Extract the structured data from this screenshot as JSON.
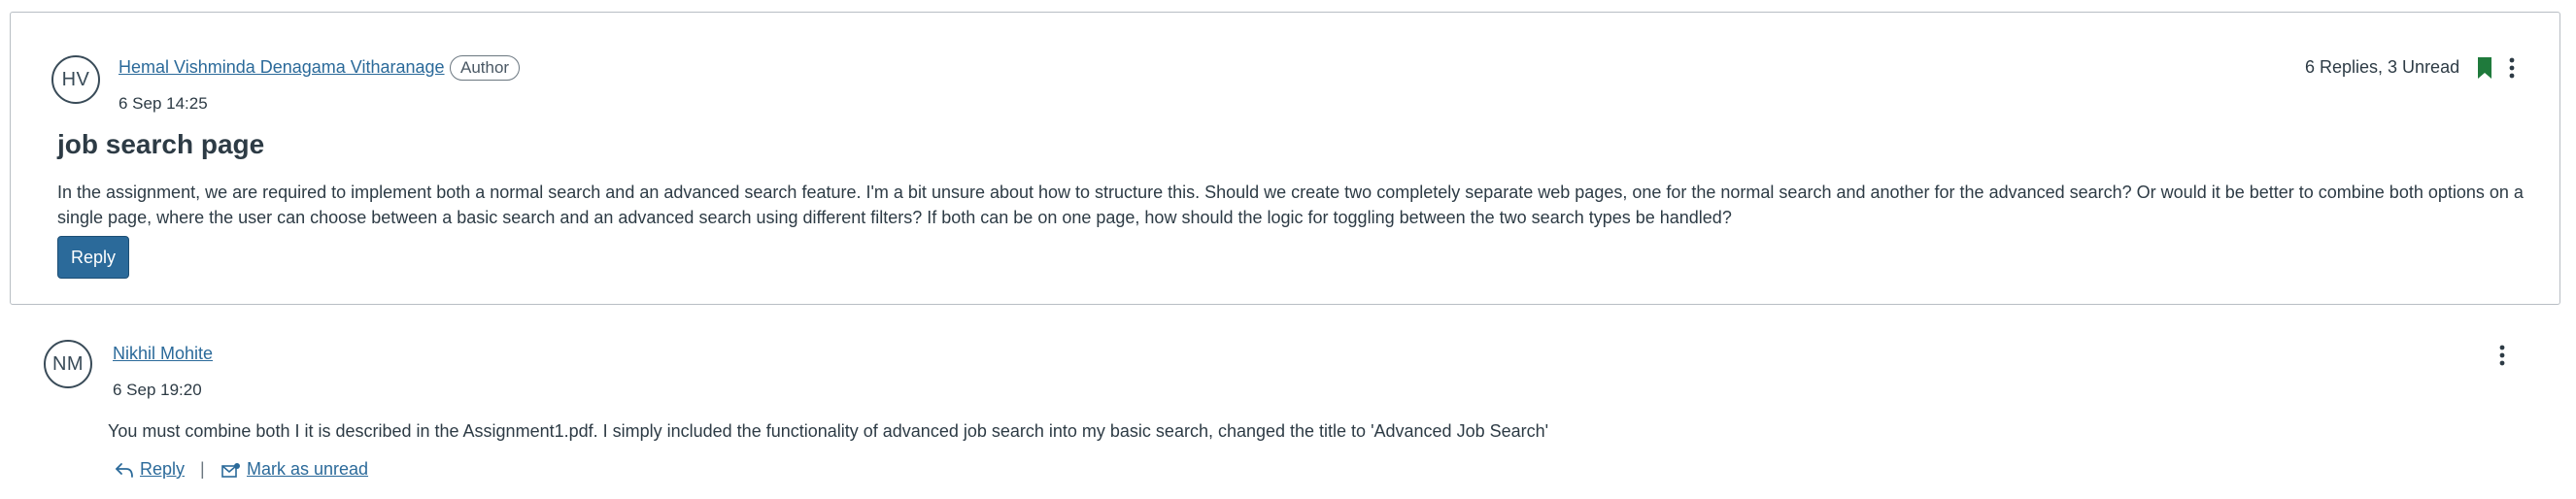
{
  "topic": {
    "avatar_initials": "HV",
    "author_name": "Hemal Vishminda Denagama Vitharanage",
    "author_role": "Author",
    "timestamp": "6 Sep 14:25",
    "replies_summary": "6 Replies, 3 Unread",
    "title": "job search page",
    "body": "In the assignment, we are required to implement both a normal search and an advanced search feature. I'm a bit unsure about how to structure this. Should we create two completely separate web pages, one for the normal search and another for the advanced search? Or would it be better to combine both options on a single page, where the user can choose between a basic search and an advanced search using different filters? If both can be on one page, how should the logic for toggling between the two search types be handled?",
    "reply_label": "Reply"
  },
  "reply": {
    "avatar_initials": "NM",
    "author_name": "Nikhil Mohite",
    "timestamp": "6 Sep 19:20",
    "body": "You must combine both I it is described in the Assignment1.pdf. I simply included the functionality of advanced job search into my basic search, changed the title to 'Advanced Job Search'",
    "reply_label": "Reply",
    "separator": "|",
    "mark_unread_label": "Mark as unread"
  },
  "icons": {
    "bookmark": "bookmark-icon",
    "kebab": "kebab-menu-icon",
    "reply_arrow": "reply-arrow-icon",
    "mark_unread": "mark-unread-icon"
  },
  "colors": {
    "link": "#2b6a9a",
    "button_bg": "#2b6a9a",
    "bookmark_green": "#1f7a3c",
    "text": "#2d3b45",
    "border": "#b8bec4"
  }
}
